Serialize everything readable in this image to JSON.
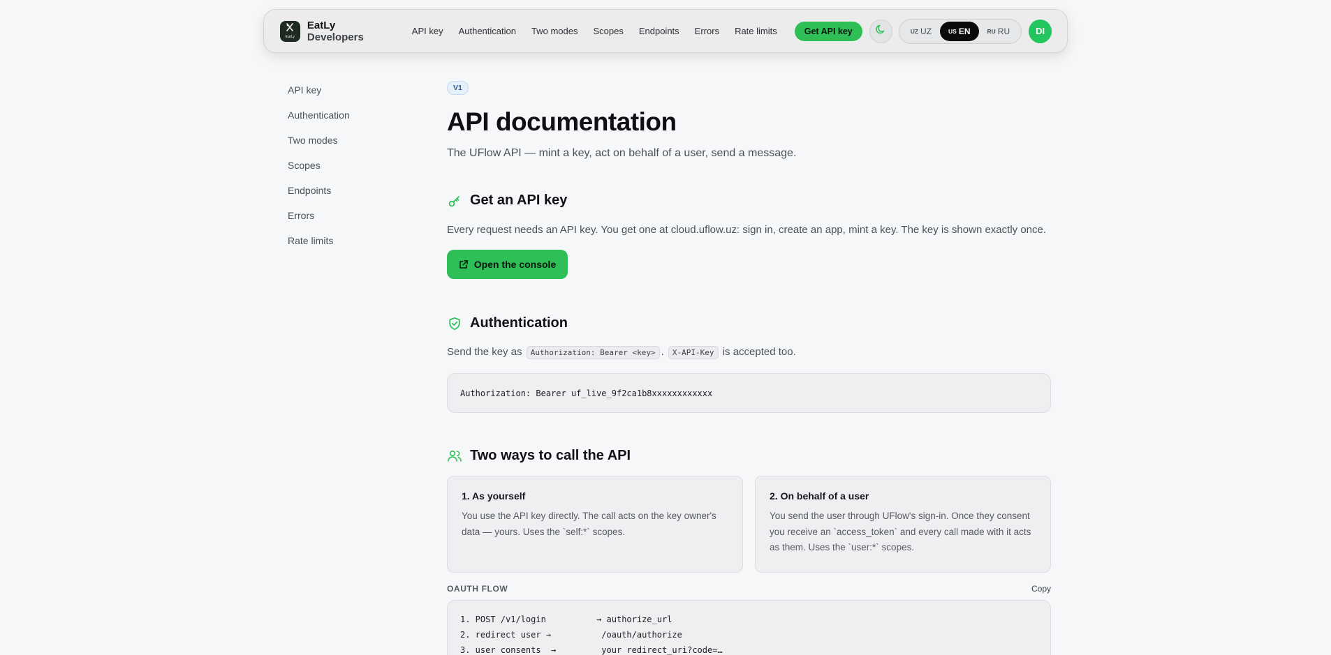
{
  "navbar": {
    "brand_logo_text": "EatLy",
    "brand_name": "EatLy",
    "brand_suffix": "Developers",
    "links": [
      "API key",
      "Authentication",
      "Two modes",
      "Scopes",
      "Endpoints",
      "Errors",
      "Rate limits"
    ],
    "cta_label": "Get API key",
    "theme_icon": "moon-icon",
    "languages": [
      {
        "code": "UZ",
        "label": "UZ",
        "active": false
      },
      {
        "code": "US",
        "label": "EN",
        "active": true
      },
      {
        "code": "RU",
        "label": "RU",
        "active": false
      }
    ],
    "avatar_initials": "DI"
  },
  "sidebar": {
    "items": [
      "API key",
      "Authentication",
      "Two modes",
      "Scopes",
      "Endpoints",
      "Errors",
      "Rate limits"
    ]
  },
  "main": {
    "version": "V1",
    "title": "API documentation",
    "subtitle": "The UFlow API — mint a key, act on behalf of a user, send a message.",
    "api_key_section": {
      "heading": "Get an API key",
      "icon": "key-icon",
      "text": "Every request needs an API key. You get one at cloud.uflow.uz: sign in, create an app, mint a key. The key is shown exactly once.",
      "button_label": "Open the console",
      "button_icon": "external-link-icon"
    },
    "auth_section": {
      "heading": "Authentication",
      "icon": "shield-check-icon",
      "text_before": "Send the key as",
      "code_1": "Authorization: Bearer <key>",
      "text_middle": ".",
      "code_2": "X-API-Key",
      "text_after": "is accepted too.",
      "code_block": "Authorization: Bearer uf_live_9f2ca1b8xxxxxxxxxxxx"
    },
    "modes_section": {
      "heading": "Two ways to call the API",
      "icon": "users-icon",
      "cards": [
        {
          "title": "1. As yourself",
          "text": "You use the API key directly. The call acts on the key owner's data — yours. Uses the `self:*` scopes."
        },
        {
          "title": "2. On behalf of a user",
          "text": "You send the user through UFlow's sign-in. Once they consent you receive an `access_token` and every call made with it acts as them. Uses the `user:*` scopes."
        }
      ],
      "flow_label": "OAUTH FLOW",
      "copy_label": "Copy",
      "flow_lines": [
        "1. POST /v1/login          → authorize_url",
        "2. redirect user →          /oauth/authorize",
        "3. user consents  →         your redirect_uri?code=…"
      ]
    }
  },
  "colors": {
    "accent": "#2fbf57",
    "background": "#f6f7f9",
    "badge_bg": "#e6f0fb",
    "badge_text": "#2c5a8a"
  }
}
